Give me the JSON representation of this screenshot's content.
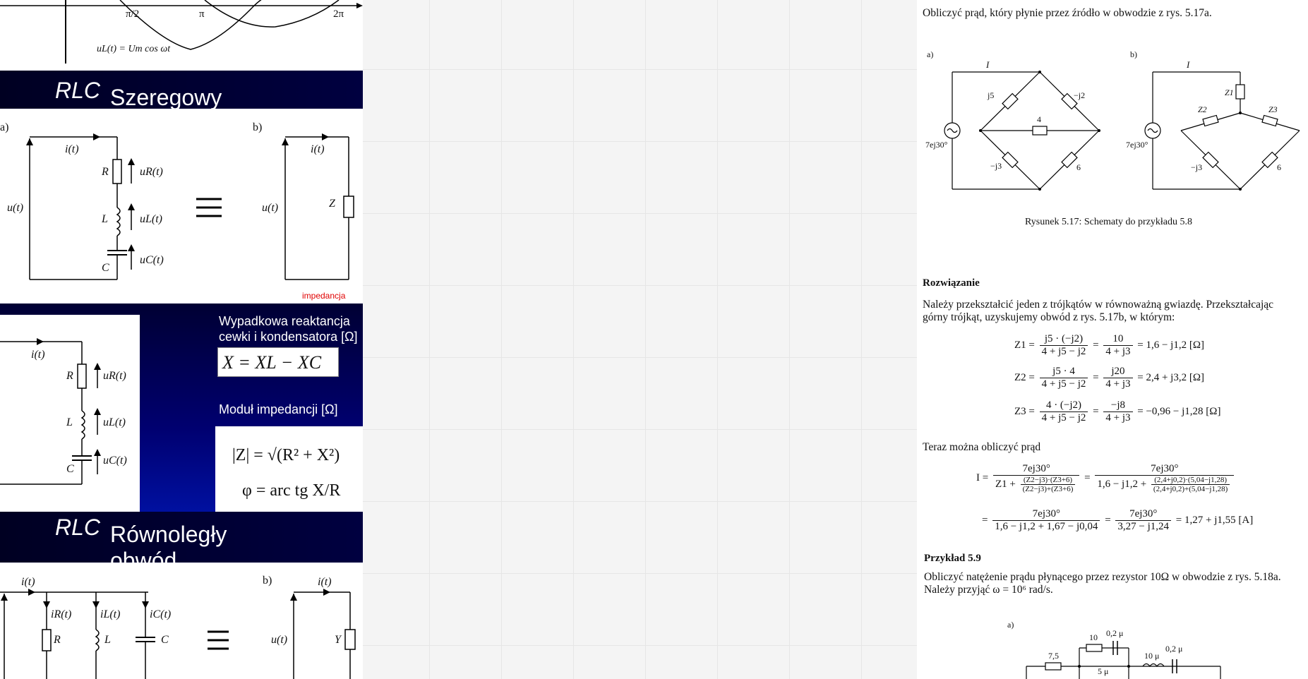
{
  "left": {
    "top_plot": {
      "ticks": [
        "π/2",
        "π",
        "2π"
      ],
      "curve_label": "uL(t) = Um cos ωt"
    },
    "bar1_title_a": "Szeregowy obwód ",
    "bar1_title_b": "RLC",
    "series": {
      "a_label": "a)",
      "b_label": "b)",
      "i": "i(t)",
      "u": "u(t)",
      "R": "R",
      "L": "L",
      "C": "C",
      "Z": "Z",
      "uR": "uR(t)",
      "uL": "uL(t)",
      "uC": "uC(t)",
      "equiv": "≡",
      "impedance_note": "impedancja"
    },
    "slide": {
      "reactance_title": "Wypadkowa reaktancja cewki i kondensatora [Ω]",
      "reactance_formula": "X = XL − XC",
      "modulus_title": "Moduł impedancji [Ω]",
      "modulus_formula": "|Z| = √(R² + X²)",
      "phase_formula": "φ = arc tg X/R"
    },
    "bar2_title_a": "Równoległy obwód ",
    "bar2_title_b": "RLC",
    "parallel": {
      "i": "i(t)",
      "iR": "iR(t)",
      "iL": "iL(t)",
      "iC": "iC(t)",
      "R": "R",
      "L": "L",
      "C": "C",
      "u": "u(t)",
      "Y": "Y",
      "b_label": "b)"
    }
  },
  "right": {
    "intro": "Obliczyć prąd, który płynie przez źródło w obwodzie z rys. 5.17a.",
    "fig_a_label": "a)",
    "fig_b_label": "b)",
    "fig_a": {
      "I": "I",
      "src": "7ej30°",
      "j5": "j5",
      "mj2": "−j2",
      "r4": "4",
      "mj3": "−j3",
      "r6": "6"
    },
    "fig_b": {
      "I": "I",
      "src": "7ej30°",
      "Z1": "Z1",
      "Z2": "Z2",
      "Z3": "Z3",
      "mj3": "−j3",
      "r6": "6"
    },
    "caption": "Rysunek 5.17: Schematy do przykładu 5.8",
    "solution_heading": "Rozwiązanie",
    "solution_line1": "Należy przekształcić jeden z trójkątów w równoważną gwiazdę. Przekształcając",
    "solution_line2": "górny trójkąt, uzyskujemy obwód z rys. 5.17b, w którym:",
    "eq_z1": {
      "lhs": "Z1 =",
      "num1": "j5 · (−j2)",
      "den1": "4 + j5 − j2",
      "num2": "10",
      "den2": "4 + j3",
      "rhs": "= 1,6 − j1,2 [Ω]"
    },
    "eq_z2": {
      "lhs": "Z2 =",
      "num1": "j5 · 4",
      "den1": "4 + j5 − j2",
      "num2": "j20",
      "den2": "4 + j3",
      "rhs": "= 2,4 + j3,2 [Ω]"
    },
    "eq_z3": {
      "lhs": "Z3 =",
      "num1": "4 · (−j2)",
      "den1": "4 + j5 − j2",
      "num2": "−j8",
      "den2": "4 + j3",
      "rhs": "= −0,96 − j1,28 [Ω]"
    },
    "now_text": "Teraz można obliczyć prąd",
    "eq_I1": {
      "lhs": "I =",
      "num1": "7ej30°",
      "den1a": "Z1 +",
      "den1_num": "(Z2−j3)·(Z3+6)",
      "den1_den": "(Z2−j3)+(Z3+6)",
      "eqsign": "=",
      "num2": "7ej30°",
      "den2a": "1,6 − j1,2 +",
      "den2_num": "(2,4+j0,2)·(5,04−j1,28)",
      "den2_den": "(2,4+j0,2)+(5,04−j1,28)"
    },
    "eq_I2": {
      "lead": "=",
      "num1": "7ej30°",
      "den1": "1,6 − j1,2 + 1,67 − j0,04",
      "eqsign": "=",
      "num2": "7ej30°",
      "den2": "3,27 − j1,24",
      "rhs": "= 1,27 + j1,55 [A]"
    },
    "example_heading": "Przykład 5.9",
    "example_line1": "Obliczyć natężenie prądu płynącego przez rezystor 10Ω w obwodzie z rys. 5.18a.",
    "example_line2": "Należy przyjąć ω = 10⁶ rad/s.",
    "fig2": {
      "label": "a)",
      "r75": "7,5",
      "r10": "10",
      "c02a": "0,2 μ",
      "l10": "10 μ",
      "c02b": "0,2 μ",
      "l5": "5 μ"
    }
  }
}
